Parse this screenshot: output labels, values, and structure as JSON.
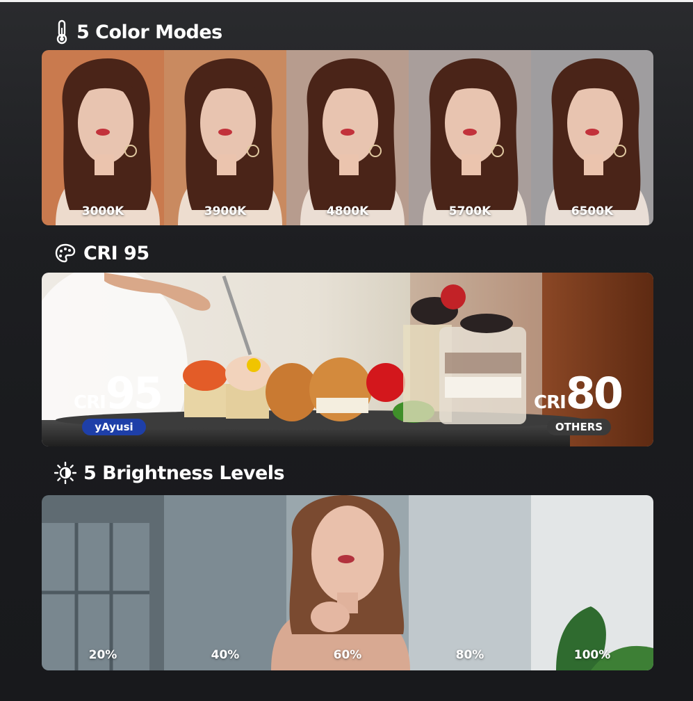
{
  "sections": {
    "color_modes": {
      "title": "5 Color Modes",
      "icon": "thermometer-icon",
      "modes": [
        {
          "label": "3000K",
          "tint": "#c97a4e"
        },
        {
          "label": "3900K",
          "tint": "#c98a60"
        },
        {
          "label": "4800K",
          "tint": "#b79c8e"
        },
        {
          "label": "5700K",
          "tint": "#a99e9b"
        },
        {
          "label": "6500K",
          "tint": "#9f9d9f"
        }
      ]
    },
    "cri": {
      "title": "CRI 95",
      "icon": "palette-icon",
      "left": {
        "prefix": "CRI",
        "value": "95",
        "badge": "yAyusi",
        "badge_color": "#1e3fa8"
      },
      "right": {
        "prefix": "CRI",
        "value": "80",
        "badge": "OTHERS",
        "badge_color": "#3a3a3a"
      }
    },
    "brightness": {
      "title": "5 Brightness Levels",
      "icon": "sun-icon",
      "levels": [
        "20%",
        "40%",
        "60%",
        "80%",
        "100%"
      ]
    }
  }
}
